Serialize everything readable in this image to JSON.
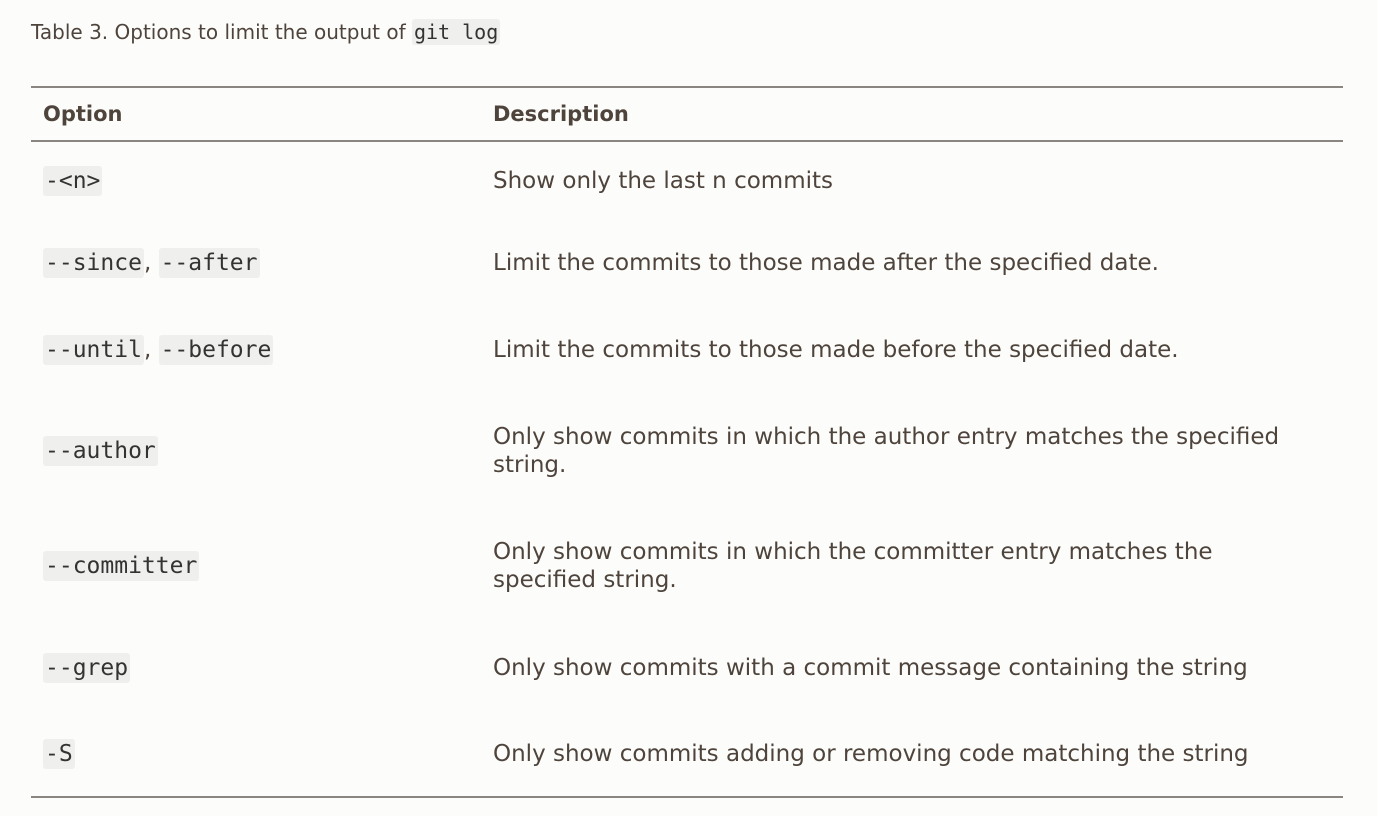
{
  "caption": {
    "prefix": "Table 3. Options to limit the output of ",
    "code": "git log"
  },
  "table": {
    "headers": [
      "Option",
      "Description"
    ],
    "rows": [
      {
        "options": [
          "-<n>"
        ],
        "description": "Show only the last n commits"
      },
      {
        "options": [
          "--since",
          "--after"
        ],
        "description": "Limit the commits to those made after the specified date."
      },
      {
        "options": [
          "--until",
          "--before"
        ],
        "description": "Limit the commits to those made before the specified date."
      },
      {
        "options": [
          "--author"
        ],
        "description": "Only show commits in which the author entry matches the specified string."
      },
      {
        "options": [
          "--committer"
        ],
        "description": "Only show commits in which the committer entry matches the specified string."
      },
      {
        "options": [
          "--grep"
        ],
        "description": "Only show commits with a commit message containing the string"
      },
      {
        "options": [
          "-S"
        ],
        "description": "Only show commits adding or removing code matching the string"
      }
    ],
    "separator": ", "
  }
}
